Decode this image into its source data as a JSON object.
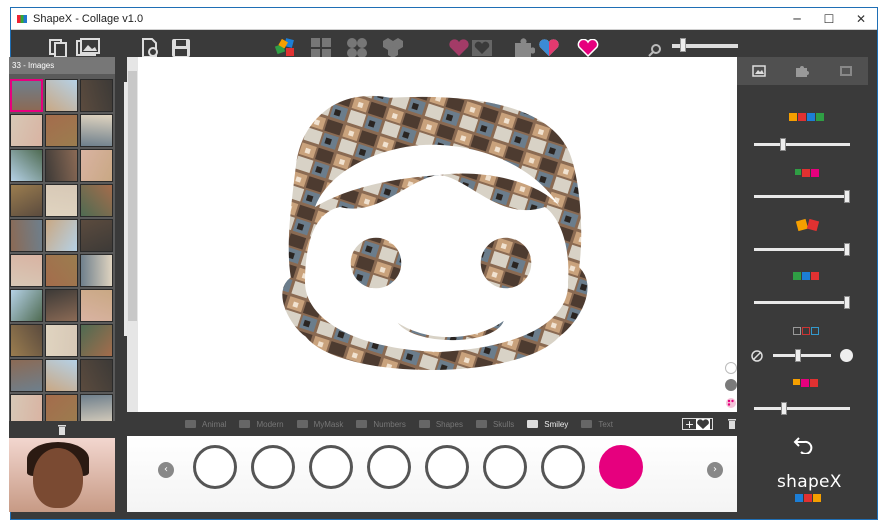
{
  "window": {
    "title": "ShapeX - Collage v1.0",
    "minimize": "─",
    "maximize": "☐",
    "close": "✕"
  },
  "left_panel": {
    "images_header": "33 - Images",
    "thumbnail_count": 33
  },
  "shape_categories": [
    {
      "label": "Animal",
      "active": false
    },
    {
      "label": "Modern",
      "active": false
    },
    {
      "label": "MyMask",
      "active": false
    },
    {
      "label": "Numbers",
      "active": false
    },
    {
      "label": "Shapes",
      "active": false
    },
    {
      "label": "Skulls",
      "active": false
    },
    {
      "label": "Smiley",
      "active": true
    },
    {
      "label": "Text",
      "active": false
    }
  ],
  "brand": {
    "name": "shapeX"
  },
  "colors": {
    "accent": "#e6007e",
    "panel": "#3a3a3a",
    "window_border": "#1f6fb5"
  },
  "icons": {
    "open_images": "open-images-icon",
    "save": "save-icon",
    "undo": "undo-icon",
    "delete": "trash-icon"
  }
}
